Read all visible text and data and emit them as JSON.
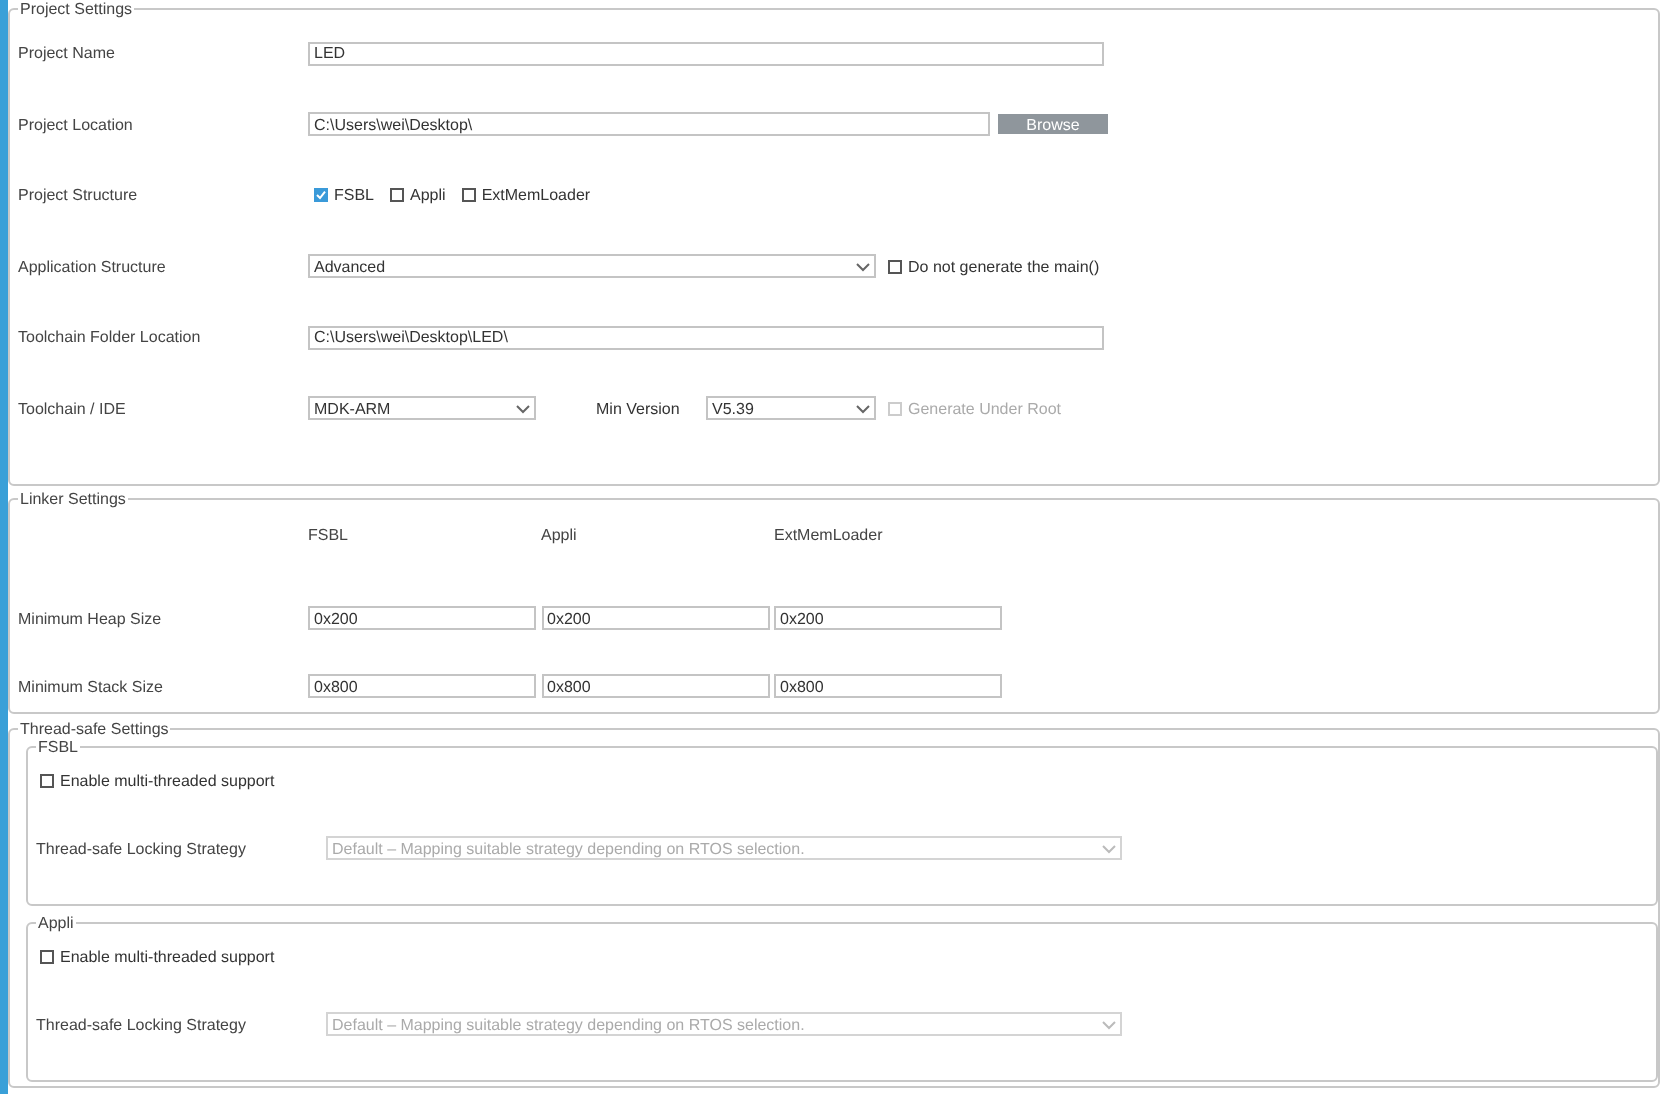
{
  "project_settings": {
    "title": "Project Settings",
    "fields": [
      {
        "kind": "text",
        "label": "Project Name",
        "value": "LED"
      },
      {
        "kind": "browse",
        "label": "Project Location",
        "value": "C:\\Users\\wei\\Desktop\\",
        "button": "Browse"
      },
      {
        "kind": "checks",
        "label": "Project Structure",
        "options": [
          {
            "label": "FSBL",
            "checked": true
          },
          {
            "label": "Appli",
            "checked": false
          },
          {
            "label": "ExtMemLoader",
            "checked": false
          }
        ]
      },
      {
        "kind": "select_check",
        "label": "Application Structure",
        "value": "Advanced",
        "check": {
          "label": "Do not generate the main()",
          "checked": false,
          "disabled": false
        }
      },
      {
        "kind": "text",
        "label": "Toolchain Folder Location",
        "value": "C:\\Users\\wei\\Desktop\\LED\\"
      },
      {
        "kind": "toolchain",
        "label": "Toolchain / IDE",
        "value": "MDK-ARM",
        "min_label": "Min Version",
        "min_value": "V5.39",
        "check": {
          "label": "Generate Under Root",
          "checked": false,
          "disabled": true
        }
      }
    ]
  },
  "linker_settings": {
    "title": "Linker Settings",
    "columns": [
      "FSBL",
      "Appli",
      "ExtMemLoader"
    ],
    "rows": [
      {
        "label": "Minimum Heap Size",
        "values": [
          "0x200",
          "0x200",
          "0x200"
        ]
      },
      {
        "label": "Minimum Stack Size",
        "values": [
          "0x800",
          "0x800",
          "0x800"
        ]
      }
    ]
  },
  "thread_safe_settings": {
    "title": "Thread-safe Settings",
    "groups": [
      {
        "title": "FSBL",
        "check": {
          "label": "Enable multi-threaded support",
          "checked": false,
          "disabled": false
        },
        "strategy_label": "Thread-safe Locking Strategy",
        "strategy": {
          "value": "Default – Mapping suitable strategy depending on RTOS selection.",
          "disabled": true
        }
      },
      {
        "title": "Appli",
        "check": {
          "label": "Enable multi-threaded support",
          "checked": false,
          "disabled": false
        },
        "strategy_label": "Thread-safe Locking Strategy",
        "strategy": {
          "value": "Default – Mapping suitable strategy depending on RTOS selection.",
          "disabled": true
        }
      }
    ]
  }
}
